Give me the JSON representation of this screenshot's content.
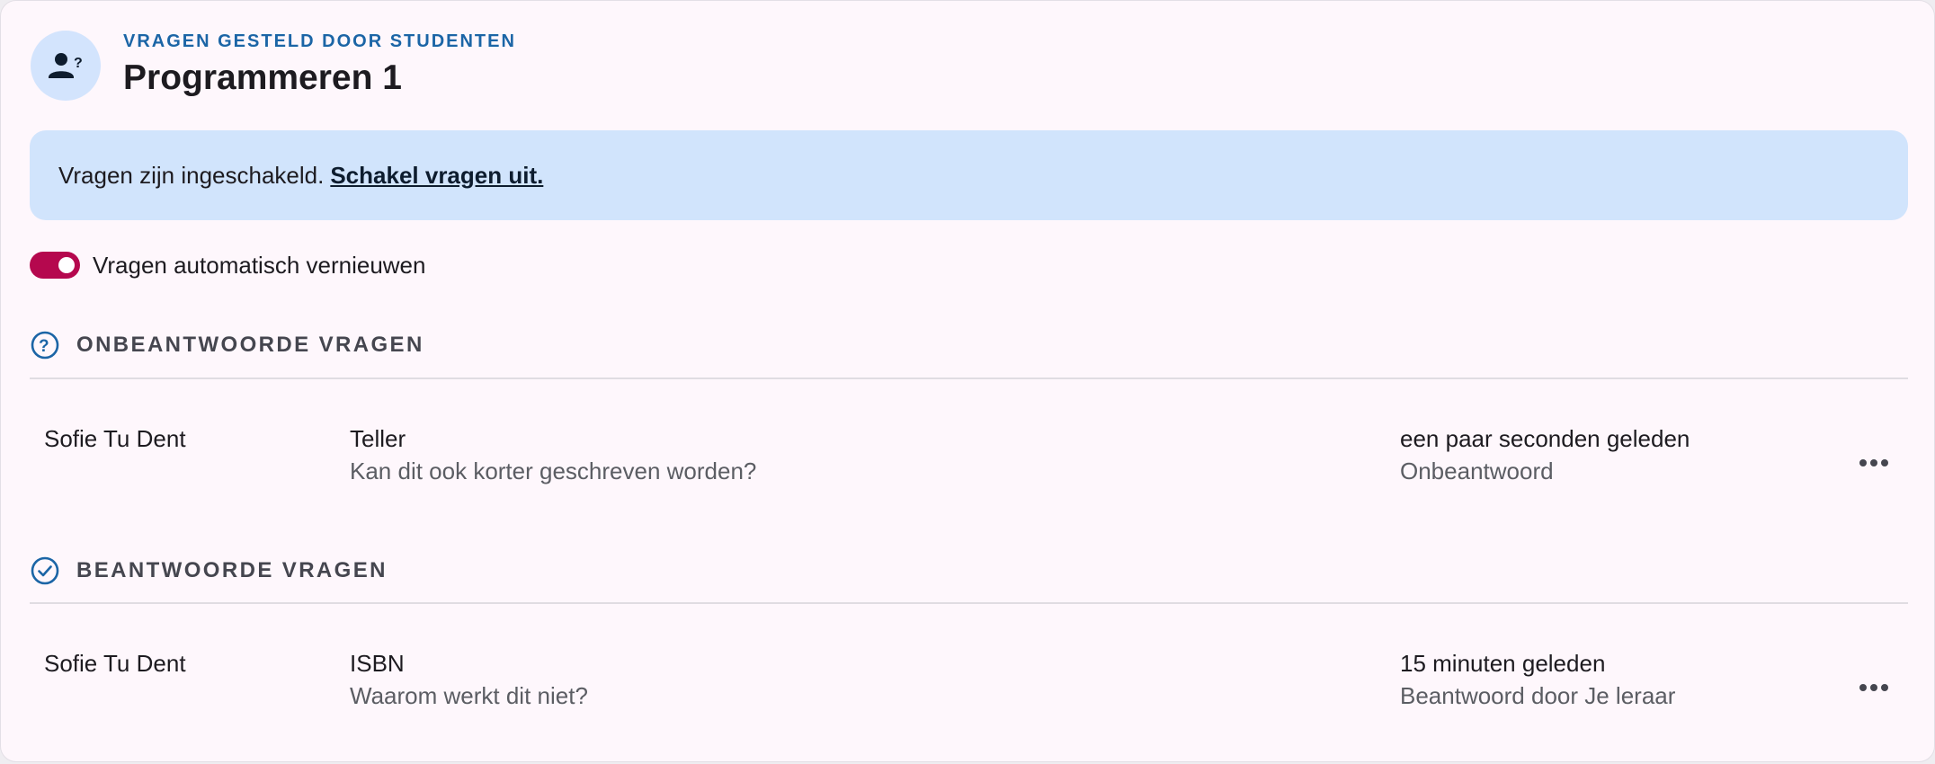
{
  "header": {
    "overline": "VRAGEN GESTELD DOOR STUDENTEN",
    "title": "Programmeren 1",
    "avatar_icon": "person-question-icon"
  },
  "alert": {
    "text": "Vragen zijn ingeschakeld.",
    "link_label": "Schakel vragen uit."
  },
  "toggle": {
    "label": "Vragen automatisch vernieuwen",
    "on": true,
    "color": "#b5084e"
  },
  "sections": {
    "unanswered": {
      "icon": "help-circle-icon",
      "label": "ONBEANTWOORDE VRAGEN",
      "items": [
        {
          "name": "Sofie Tu Dent",
          "title": "Teller",
          "body": "Kan dit ook korter geschreven worden?",
          "time": "een paar seconden geleden",
          "status": "Onbeantwoord"
        }
      ]
    },
    "answered": {
      "icon": "check-circle-icon",
      "label": "BEANTWOORDE VRAGEN",
      "items": [
        {
          "name": "Sofie Tu Dent",
          "title": "ISBN",
          "body": "Waarom werkt dit niet?",
          "time": "15 minuten geleden",
          "status": "Beantwoord door Je leraar"
        }
      ]
    }
  },
  "colors": {
    "accent": "#1b65a6",
    "alert_bg": "#d1e4fc",
    "card_bg": "#fef7fc"
  }
}
